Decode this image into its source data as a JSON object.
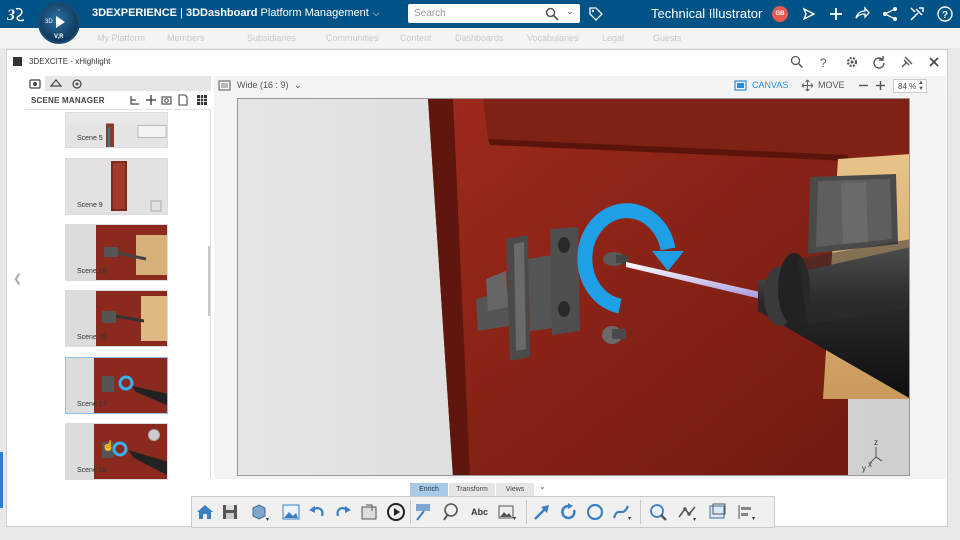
{
  "topbar": {
    "brand_prefix": "3DEXPERIENCE",
    "brand_sep": " | ",
    "brand_app": "3DDashboard",
    "brand_context": " Platform Management",
    "compass_label": "V,R",
    "search_placeholder": "Search",
    "username": "Technical Illustrator",
    "avatar_initials": "GB",
    "colors": {
      "bar": "#005386",
      "avatar": "#e85a4f"
    },
    "icons": [
      "share-icon",
      "add-icon",
      "forward-icon",
      "network-icon",
      "tools-icon",
      "help-icon"
    ]
  },
  "dashboard_tabs": [
    "My Platform",
    "Members",
    "Subsidiaries",
    "Communities",
    "Content",
    "Dashboards",
    "Vocabularies",
    "Legal",
    "Guests"
  ],
  "app": {
    "title": "3DEXCITE - xHighlight",
    "header_icons": [
      "search-icon",
      "help-icon",
      "settings-icon",
      "refresh-icon",
      "pin-icon",
      "close-icon"
    ]
  },
  "scene_manager": {
    "title": "SCENE MANAGER",
    "scenes": [
      {
        "label": "Scene 5",
        "selected": false
      },
      {
        "label": "Scene 9",
        "selected": false
      },
      {
        "label": "Scene 16",
        "selected": false
      },
      {
        "label": "Scene 15",
        "selected": false
      },
      {
        "label": "Scene 17",
        "selected": true
      },
      {
        "label": "Scene 18",
        "selected": false
      }
    ]
  },
  "viewer": {
    "aspect": "Wide (16 : 9)",
    "mode_canvas": "CANVAS",
    "mode_move": "MOVE",
    "zoom": "84 %",
    "axis_labels": {
      "z": "z",
      "y": "y",
      "x": "x"
    }
  },
  "toolbar": {
    "tabs": [
      "Enrich",
      "Transform",
      "Views"
    ],
    "active_tab": "Enrich",
    "abc_label": "Abc",
    "accent": "#2a8bd8"
  }
}
